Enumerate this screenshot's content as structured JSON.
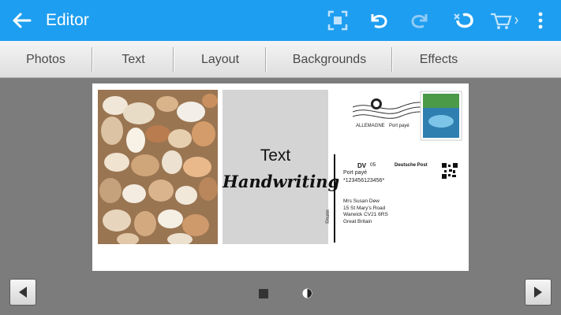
{
  "appbar": {
    "title": "Editor",
    "icons": [
      "back-arrow-icon",
      "crop-icon",
      "undo-icon",
      "redo-icon",
      "rotate-icon",
      "cart-icon",
      "more-vert-icon"
    ],
    "color": "#1e9ef0"
  },
  "tabs": [
    {
      "label": "Photos"
    },
    {
      "label": "Text"
    },
    {
      "label": "Layout"
    },
    {
      "label": "Backgrounds"
    },
    {
      "label": "Effects"
    }
  ],
  "postcard": {
    "text_line": "Text",
    "handwriting_line": "Handwriting",
    "vertical_label": "©nunn",
    "stamp_country": "ALLEMAGNE",
    "stamp_status": "Port payé",
    "dv_label": "DV",
    "dv_number": "05",
    "brand": "Deutsche Post",
    "port_paye": "Port payé",
    "barcode_text": "*123456123456*",
    "address": [
      "Mrs Susan Dew",
      "15 St Mary's Road",
      "Warwick CV21 6RS",
      "Great Britain"
    ]
  },
  "bottom": {
    "icons": [
      "prev-arrow-icon",
      "front-side-icon",
      "back-side-icon",
      "next-arrow-icon"
    ]
  }
}
